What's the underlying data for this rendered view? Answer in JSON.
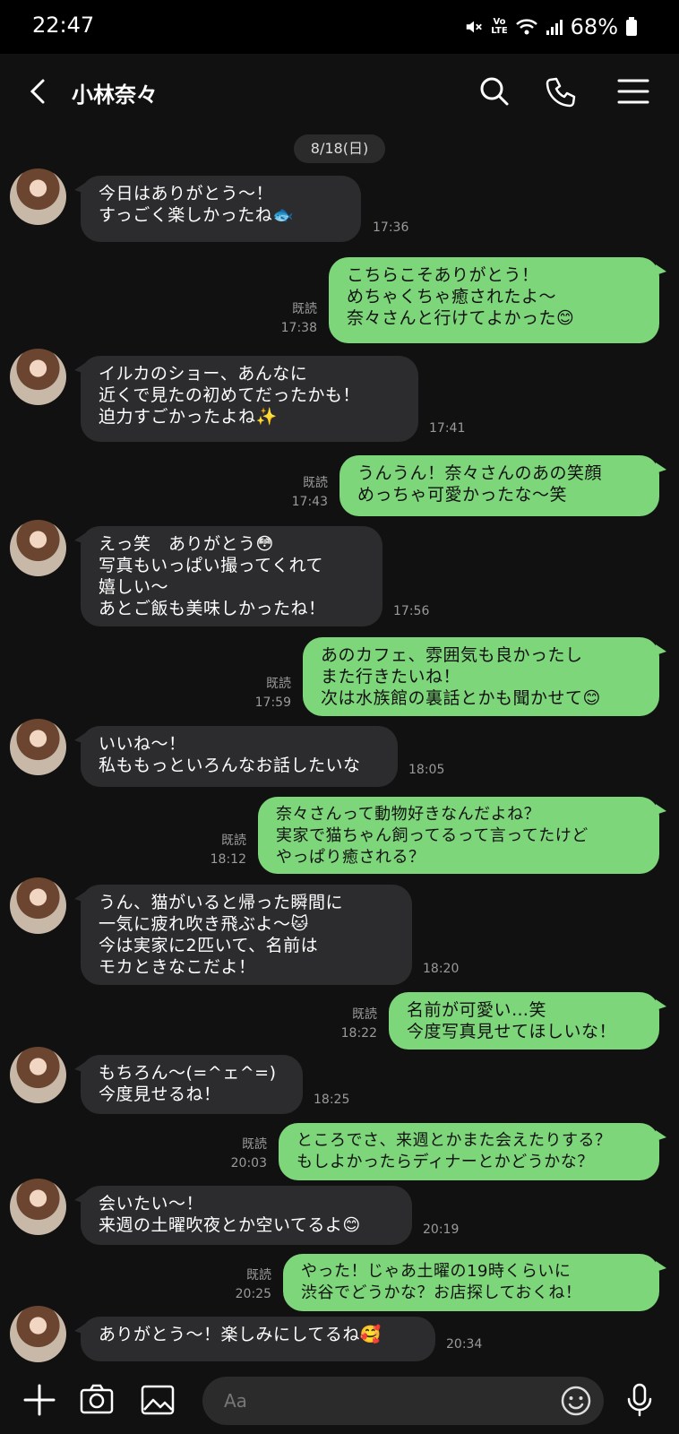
{
  "status_bar": {
    "time": "22:47",
    "volte_top": "Vo",
    "volte_bottom": "LTE",
    "battery": "68%"
  },
  "header": {
    "title": "小林奈々"
  },
  "chat": {
    "date": "8/18(日)",
    "read_label": "既読",
    "messages": [
      {
        "dir": "in",
        "text": "今日はありがとう〜！\nすっごく楽しかったね🐟",
        "time": "17:36"
      },
      {
        "dir": "out",
        "text": "こちらこそありがとう！\nめちゃくちゃ癒されたよ〜\n奈々さんと行けてよかった😊",
        "time": "17:38",
        "read": "既読"
      },
      {
        "dir": "in",
        "text": "イルカのショー、あんなに\n近くで見たの初めてだったかも！\n迫力すごかったよね✨",
        "time": "17:41"
      },
      {
        "dir": "out",
        "text": "うんうん！奈々さんのあの笑顔\nめっちゃ可愛かったな〜笑",
        "time": "17:43",
        "read": "既読"
      },
      {
        "dir": "in",
        "text": "えっ笑　ありがとう😳\n写真もいっぱい撮ってくれて\n嬉しい〜\nあとご飯も美味しかったね！",
        "time": "17:56"
      },
      {
        "dir": "out",
        "text": "あのカフェ、雰囲気も良かったし\nまた行きたいね！\n次は水族館の裏話とかも聞かせて😊",
        "time": "17:59",
        "read": "既読"
      },
      {
        "dir": "in",
        "text": "いいね〜！\n私ももっといろんなお話したいな",
        "time": "18:05"
      },
      {
        "dir": "out",
        "text": "奈々さんって動物好きなんだよね？\n実家で猫ちゃん飼ってるって言ってたけど\nやっぱり癒される？",
        "time": "18:12",
        "read": "既読"
      },
      {
        "dir": "in",
        "text": "うん、猫がいると帰った瞬間に\n一気に疲れ吹き飛ぶよ〜🐱\n今は実家に2匹いて、名前は\nモカときなこだよ！",
        "time": "18:20"
      },
      {
        "dir": "out",
        "text": "名前が可愛い…笑\n今度写真見せてほしいな！",
        "time": "18:22",
        "read": "既読"
      },
      {
        "dir": "in",
        "text": "もちろん〜(=^ェ^=)\n今度見せるね！",
        "time": "18:25"
      },
      {
        "dir": "out",
        "text": "ところでさ、来週とかまた会えたりする？\nもしよかったらディナーとかどうかな？",
        "time": "20:03",
        "read": "既読"
      },
      {
        "dir": "in",
        "text": "会いたい〜！\n来週の土曜吹夜とか空いてるよ😊",
        "time": "20:19"
      },
      {
        "dir": "out",
        "text": "やった！じゃあ土曜の19時くらいに\n渋谷でどうかな？お店探しておくね！",
        "time": "20:25",
        "read": "既読"
      },
      {
        "dir": "in",
        "text": "ありがとう〜！楽しみにしてるね🥰",
        "time": "20:34"
      }
    ]
  },
  "input_bar": {
    "placeholder": "Aa"
  },
  "colors": {
    "background": "#111111",
    "incoming_bubble": "#2c2c2e",
    "outgoing_bubble": "#7ed67b"
  }
}
